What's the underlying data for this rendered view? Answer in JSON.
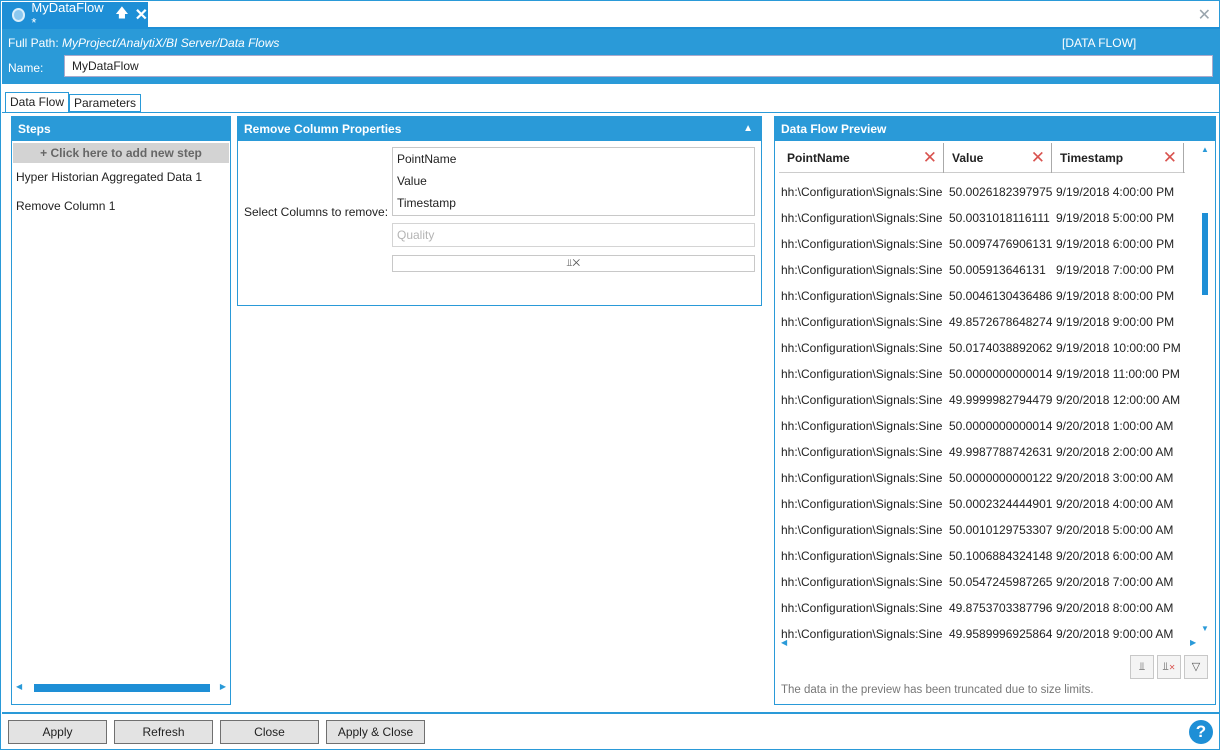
{
  "tab": {
    "title": "MyDataFlow *",
    "pin_icon": "pin-icon",
    "close_icon": "close-icon"
  },
  "window": {
    "close_icon": "close-icon"
  },
  "header": {
    "full_path_label": "Full Path:",
    "full_path_value": "MyProject/AnalytiX/BI Server/Data Flows",
    "object_type": "[DATA FLOW]",
    "name_label": "Name:",
    "name_value": "MyDataFlow"
  },
  "editor_tabs": [
    "Data Flow",
    "Parameters"
  ],
  "steps": {
    "title": "Steps",
    "add_step": "+ Click here to add new step",
    "items": [
      "Hyper Historian Aggregated Data  1",
      "Remove Column  1"
    ]
  },
  "remove_column": {
    "title": "Remove Column Properties",
    "select_label": "Select Columns to remove:",
    "columns": [
      "PointName",
      "Value",
      "Timestamp"
    ],
    "placeholder": "Quality"
  },
  "preview": {
    "title": "Data Flow Preview",
    "headers": [
      "PointName",
      "Value",
      "Timestamp"
    ],
    "rows": [
      [
        "hh:\\Configuration\\Signals:Sine",
        "50.0026182397975",
        "9/19/2018 4:00:00 PM"
      ],
      [
        "hh:\\Configuration\\Signals:Sine",
        "50.0031018116111",
        "9/19/2018 5:00:00 PM"
      ],
      [
        "hh:\\Configuration\\Signals:Sine",
        "50.0097476906131",
        "9/19/2018 6:00:00 PM"
      ],
      [
        "hh:\\Configuration\\Signals:Sine",
        "50.005913646131",
        "9/19/2018 7:00:00 PM"
      ],
      [
        "hh:\\Configuration\\Signals:Sine",
        "50.0046130436486",
        "9/19/2018 8:00:00 PM"
      ],
      [
        "hh:\\Configuration\\Signals:Sine",
        "49.8572678648274",
        "9/19/2018 9:00:00 PM"
      ],
      [
        "hh:\\Configuration\\Signals:Sine",
        "50.0174038892062",
        "9/19/2018 10:00:00 PM"
      ],
      [
        "hh:\\Configuration\\Signals:Sine",
        "50.0000000000014",
        "9/19/2018 11:00:00 PM"
      ],
      [
        "hh:\\Configuration\\Signals:Sine",
        "49.9999982794479",
        "9/20/2018 12:00:00 AM"
      ],
      [
        "hh:\\Configuration\\Signals:Sine",
        "50.0000000000014",
        "9/20/2018 1:00:00 AM"
      ],
      [
        "hh:\\Configuration\\Signals:Sine",
        "49.9987788742631",
        "9/20/2018 2:00:00 AM"
      ],
      [
        "hh:\\Configuration\\Signals:Sine",
        "50.0000000000122",
        "9/20/2018 3:00:00 AM"
      ],
      [
        "hh:\\Configuration\\Signals:Sine",
        "50.0002324444901",
        "9/20/2018 4:00:00 AM"
      ],
      [
        "hh:\\Configuration\\Signals:Sine",
        "50.0010129753307",
        "9/20/2018 5:00:00 AM"
      ],
      [
        "hh:\\Configuration\\Signals:Sine",
        "50.1006884324148",
        "9/20/2018 6:00:00 AM"
      ],
      [
        "hh:\\Configuration\\Signals:Sine",
        "50.0547245987265",
        "9/20/2018 7:00:00 AM"
      ],
      [
        "hh:\\Configuration\\Signals:Sine",
        "49.8753703387796",
        "9/20/2018 8:00:00 AM"
      ],
      [
        "hh:\\Configuration\\Signals:Sine",
        "49.9589996925864",
        "9/20/2018 9:00:00 AM"
      ]
    ],
    "toolbar_icons": [
      "column-chooser-icon",
      "remove-columns-icon",
      "filter-icon"
    ],
    "truncation_note": "The data in the preview has been truncated due to size limits."
  },
  "buttons": {
    "apply": "Apply",
    "refresh": "Refresh",
    "close": "Close",
    "apply_close": "Apply & Close"
  },
  "help": {
    "label": "?"
  },
  "colors": {
    "accent": "#2a9ad8",
    "tab": "#1e8fd6",
    "remove_red": "#d9534f"
  }
}
